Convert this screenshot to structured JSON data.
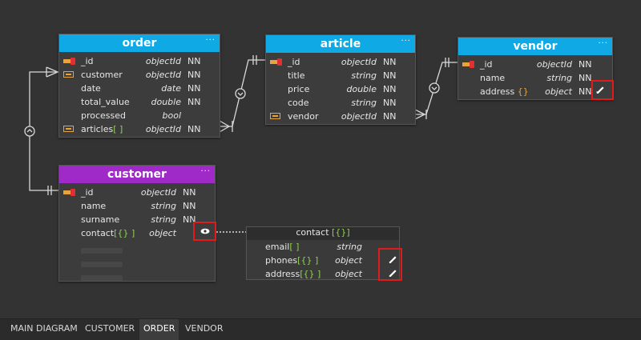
{
  "entities": {
    "order": {
      "title": "order",
      "rows": [
        {
          "name": "_id",
          "type": "objectId",
          "nn": "NN"
        },
        {
          "name": "customer",
          "type": "objectId",
          "nn": "NN"
        },
        {
          "name": "date",
          "type": "date",
          "nn": "NN"
        },
        {
          "name": "total_value",
          "type": "double",
          "nn": "NN"
        },
        {
          "name": "processed",
          "type": "bool",
          "nn": ""
        },
        {
          "name": "articles",
          "suffix": "[ ]",
          "type": "objectId",
          "nn": "NN"
        }
      ]
    },
    "article": {
      "title": "article",
      "rows": [
        {
          "name": "_id",
          "type": "objectId",
          "nn": "NN"
        },
        {
          "name": "title",
          "type": "string",
          "nn": "NN"
        },
        {
          "name": "price",
          "type": "double",
          "nn": "NN"
        },
        {
          "name": "code",
          "type": "string",
          "nn": "NN"
        },
        {
          "name": "vendor",
          "type": "objectId",
          "nn": "NN"
        }
      ]
    },
    "vendor": {
      "title": "vendor",
      "rows": [
        {
          "name": "_id",
          "type": "objectId",
          "nn": "NN"
        },
        {
          "name": "name",
          "type": "string",
          "nn": "NN"
        },
        {
          "name": "address",
          "suffix": "{}",
          "type": "object",
          "nn": "NN"
        }
      ]
    },
    "customer": {
      "title": "customer",
      "rows": [
        {
          "name": "_id",
          "type": "objectId",
          "nn": "NN"
        },
        {
          "name": "name",
          "type": "string",
          "nn": "NN"
        },
        {
          "name": "surname",
          "type": "string",
          "nn": "NN"
        },
        {
          "name": "contact",
          "suffix": "[{} ]",
          "type": "object",
          "nn": ""
        }
      ]
    }
  },
  "subdocument": {
    "title": "contact",
    "title_suffix": "[{}]",
    "rows": [
      {
        "name": "email",
        "suffix": "[ ]",
        "type": "string"
      },
      {
        "name": "phones",
        "suffix": "[{} ]",
        "type": "object"
      },
      {
        "name": "address",
        "suffix": "[{} ]",
        "type": "object"
      }
    ]
  },
  "menu_glyph": "···",
  "tabs": [
    {
      "label": "MAIN DIAGRAM",
      "active": false
    },
    {
      "label": "CUSTOMER",
      "active": false
    },
    {
      "label": "ORDER",
      "active": true
    },
    {
      "label": "VENDOR",
      "active": false
    }
  ],
  "colors": {
    "entity_header": "#0fa9e6",
    "subdoc_entity_header": "#a02ac8",
    "highlight": "#e01b1b"
  }
}
